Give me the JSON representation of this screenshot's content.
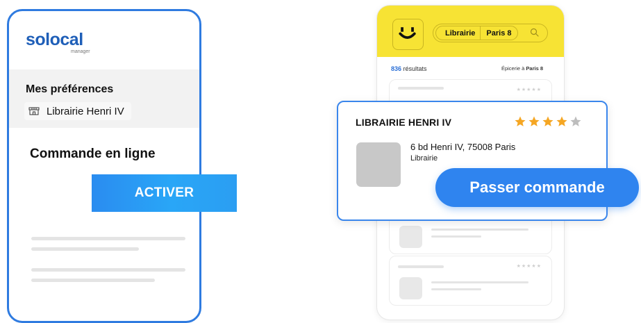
{
  "left_app": {
    "logo": "solocal",
    "logo_sub": "manager",
    "preferences_title": "Mes préférences",
    "preferred_store": "Librairie Henri IV",
    "store_icon": "storefront-icon",
    "order_title": "Commande en ligne",
    "activate_button": "ACTIVER"
  },
  "right_app": {
    "app_icon": "smile-logo-icon",
    "search_what": "Librairie",
    "search_where": "Paris 8",
    "results_count": "836",
    "results_label": "résultats",
    "filter_label": "Épicerie à",
    "filter_place": "Paris 8"
  },
  "business": {
    "name": "LIBRAIRIE HENRI IV",
    "rating": 4,
    "rating_max": 5,
    "address": "6 bd Henri IV, 75008 Paris",
    "category": "Librairie",
    "order_button": "Passer commande"
  },
  "colors": {
    "brand_blue": "#2f84ef",
    "header_yellow": "#f7e334",
    "star_orange": "#f5a623",
    "star_grey": "#bdbdbd"
  }
}
